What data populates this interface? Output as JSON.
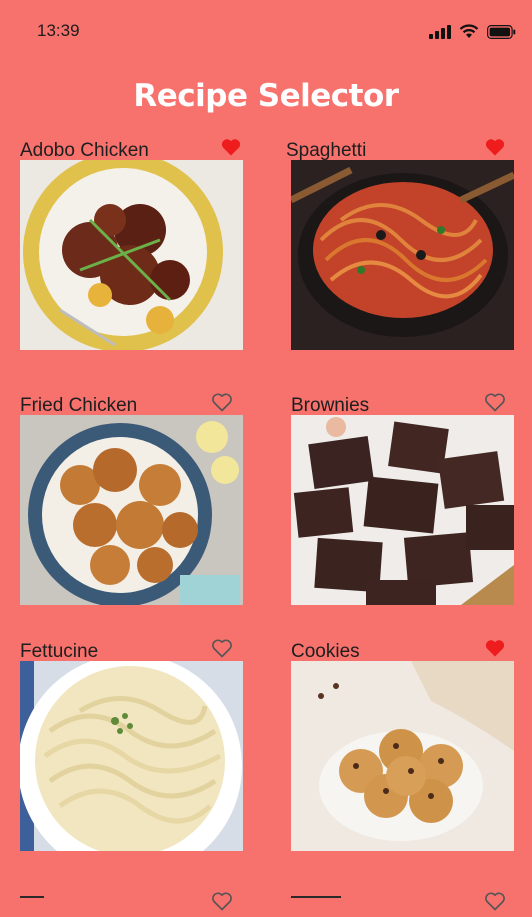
{
  "status": {
    "time": "13:39"
  },
  "app": {
    "title": "Recipe Selector"
  },
  "recipes": [
    {
      "name": "Adobo Chicken",
      "favorite": true
    },
    {
      "name": "Spaghetti",
      "favorite": true
    },
    {
      "name": "Fried Chicken",
      "favorite": false
    },
    {
      "name": "Brownies",
      "favorite": false
    },
    {
      "name": "Fettucine",
      "favorite": false
    },
    {
      "name": "Cookies",
      "favorite": true
    },
    {
      "name": "",
      "favorite": false
    },
    {
      "name": "",
      "favorite": false
    }
  ],
  "colors": {
    "background": "#f7716d",
    "heart_filled": "#ee1c1c",
    "heart_outline": "#555555"
  },
  "icons": {
    "favorite": "heart-icon",
    "signal": "cellular-signal-icon",
    "wifi": "wifi-icon",
    "battery": "battery-icon"
  }
}
